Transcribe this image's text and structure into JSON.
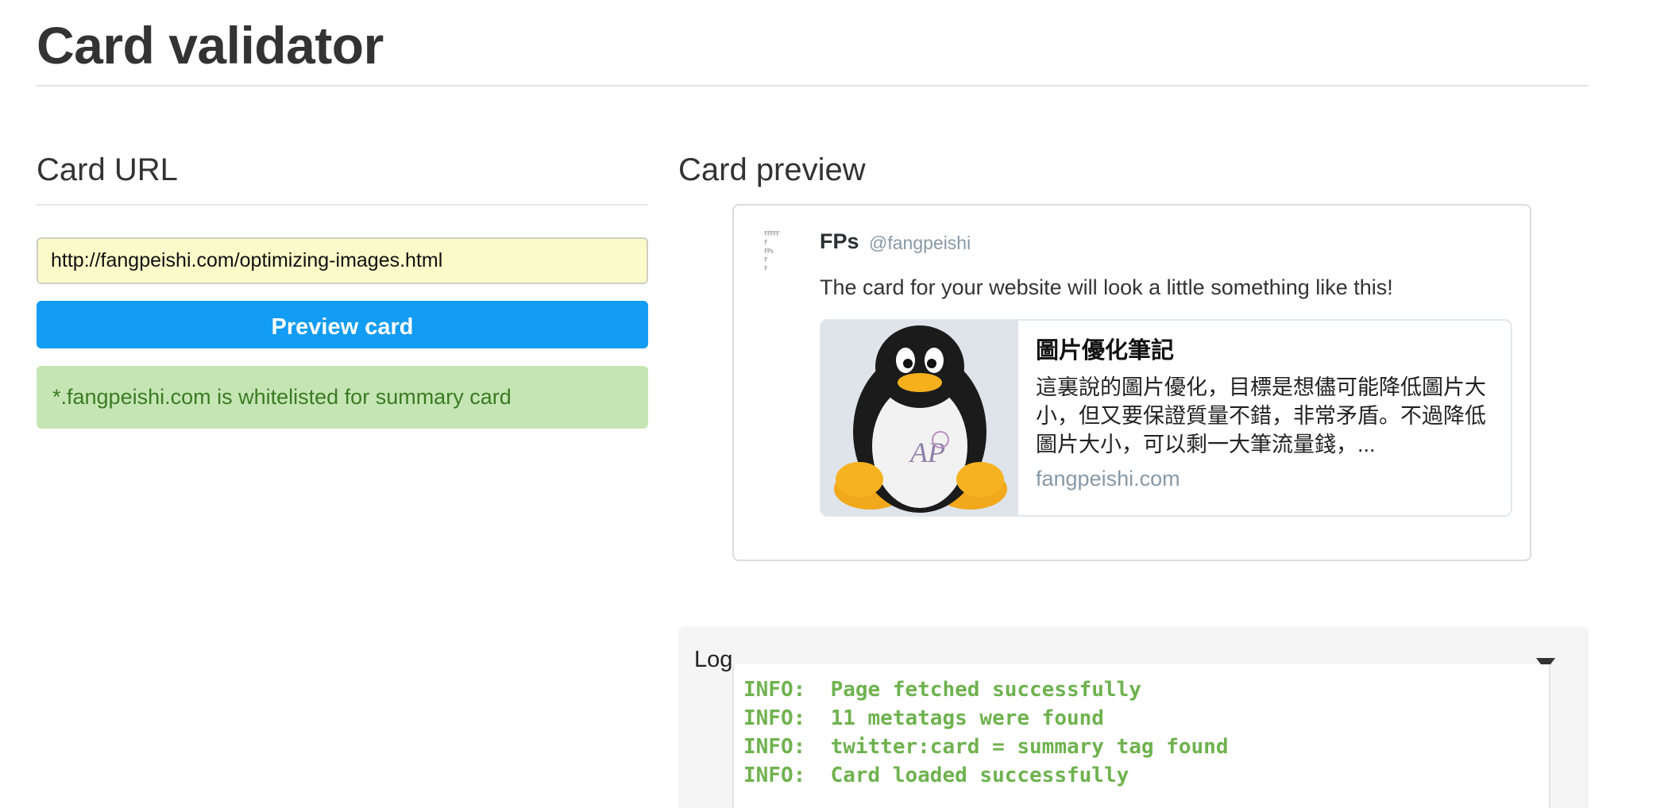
{
  "page": {
    "title": "Card validator"
  },
  "form": {
    "heading": "Card URL",
    "url_value": "http://fangpeishi.com/optimizing-images.html",
    "preview_button_label": "Preview card",
    "status_message": "*.fangpeishi.com is whitelisted for summary card"
  },
  "preview": {
    "heading": "Card preview",
    "author_name": "FPs",
    "author_handle": "@fangpeishi",
    "tweet_text": "The card for your website will look a little something like this!",
    "card": {
      "title": "圖片優化筆記",
      "description": "這裏說的圖片優化，目標是想儘可能降低圖片大小，但又要保證質量不錯，非常矛盾。不過降低圖片大小，可以剩一大筆流量錢，...",
      "domain": "fangpeishi.com",
      "image_icon": "tux-penguin-icon"
    }
  },
  "log": {
    "label": "Log",
    "lines": [
      "INFO:  Page fetched successfully",
      "INFO:  11 metatags were found",
      "INFO:  twitter:card = summary tag found",
      "INFO:  Card loaded successfully"
    ]
  },
  "colors": {
    "button": "#129cf3",
    "alert_bg": "#c5e6b4",
    "alert_text": "#3a7a23",
    "input_bg": "#fafbc8",
    "log_text": "#6fb24f"
  }
}
